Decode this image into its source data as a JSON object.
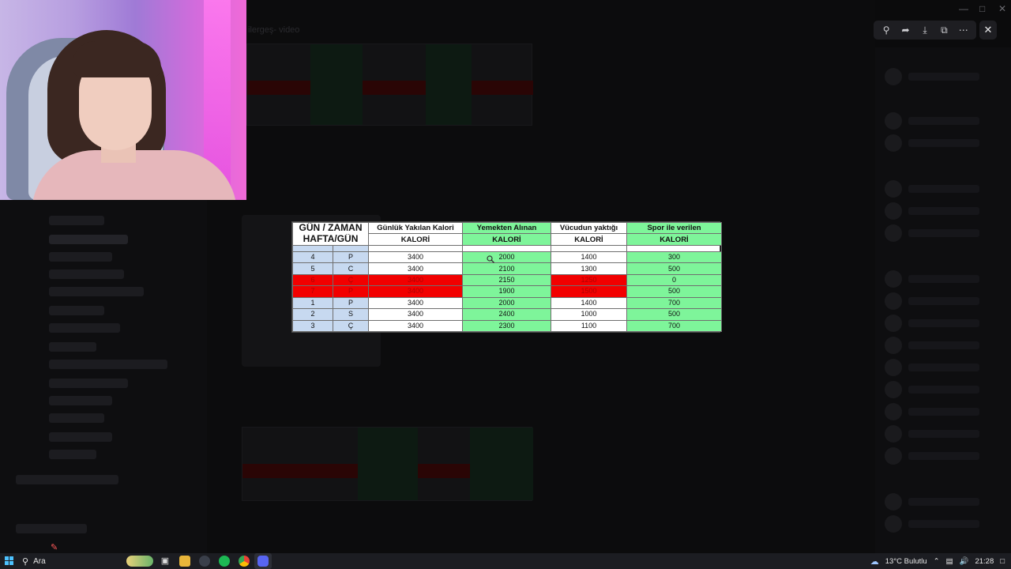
{
  "background_app": {
    "channel_title": "ilergeş- video"
  },
  "viewer_toolbar": {
    "zoom_icon": "zoom-in-icon",
    "forward_icon": "share-icon",
    "download_icon": "download-icon",
    "open_icon": "open-external-icon",
    "more_icon": "more-icon",
    "close_icon": "close-icon"
  },
  "sheet": {
    "header1": {
      "col1": "GÜN / ZAMAN",
      "col3": "Günlük Yakılan Kalori",
      "col4": "Yemekten Alınan",
      "col5": "Vücudun yaktığı",
      "col6": "Spor ile verilen"
    },
    "header2": {
      "col1": "HAFTA/GÜN",
      "col3": "KALORİ",
      "col4": "KALORİ",
      "col5": "KALORİ",
      "col6": "KALORİ"
    },
    "rows": [
      {
        "week": "4",
        "day": "P",
        "burned": "3400",
        "food": "2000",
        "body": "1400",
        "sport": "300",
        "highlight": false
      },
      {
        "week": "5",
        "day": "C",
        "burned": "3400",
        "food": "2100",
        "body": "1300",
        "sport": "500",
        "highlight": false
      },
      {
        "week": "6",
        "day": "Ç",
        "burned": "3400",
        "food": "2150",
        "body": "1250",
        "sport": "0",
        "highlight": true
      },
      {
        "week": "7",
        "day": "P",
        "burned": "3400",
        "food": "1900",
        "body": "1500",
        "sport": "500",
        "highlight": true
      },
      {
        "week": "1",
        "day": "P",
        "burned": "3400",
        "food": "2000",
        "body": "1400",
        "sport": "700",
        "highlight": false
      },
      {
        "week": "2",
        "day": "S",
        "burned": "3400",
        "food": "2400",
        "body": "1000",
        "sport": "500",
        "highlight": false
      },
      {
        "week": "3",
        "day": "Ç",
        "burned": "3400",
        "food": "2300",
        "body": "1100",
        "sport": "700",
        "highlight": false
      }
    ],
    "colors": {
      "green": "#7ef59a",
      "red": "#f20000",
      "blue": "#c7d9f0"
    }
  },
  "taskbar": {
    "search_label": "Ara",
    "weather": "13°C  Bulutlu",
    "time": "21:28"
  }
}
